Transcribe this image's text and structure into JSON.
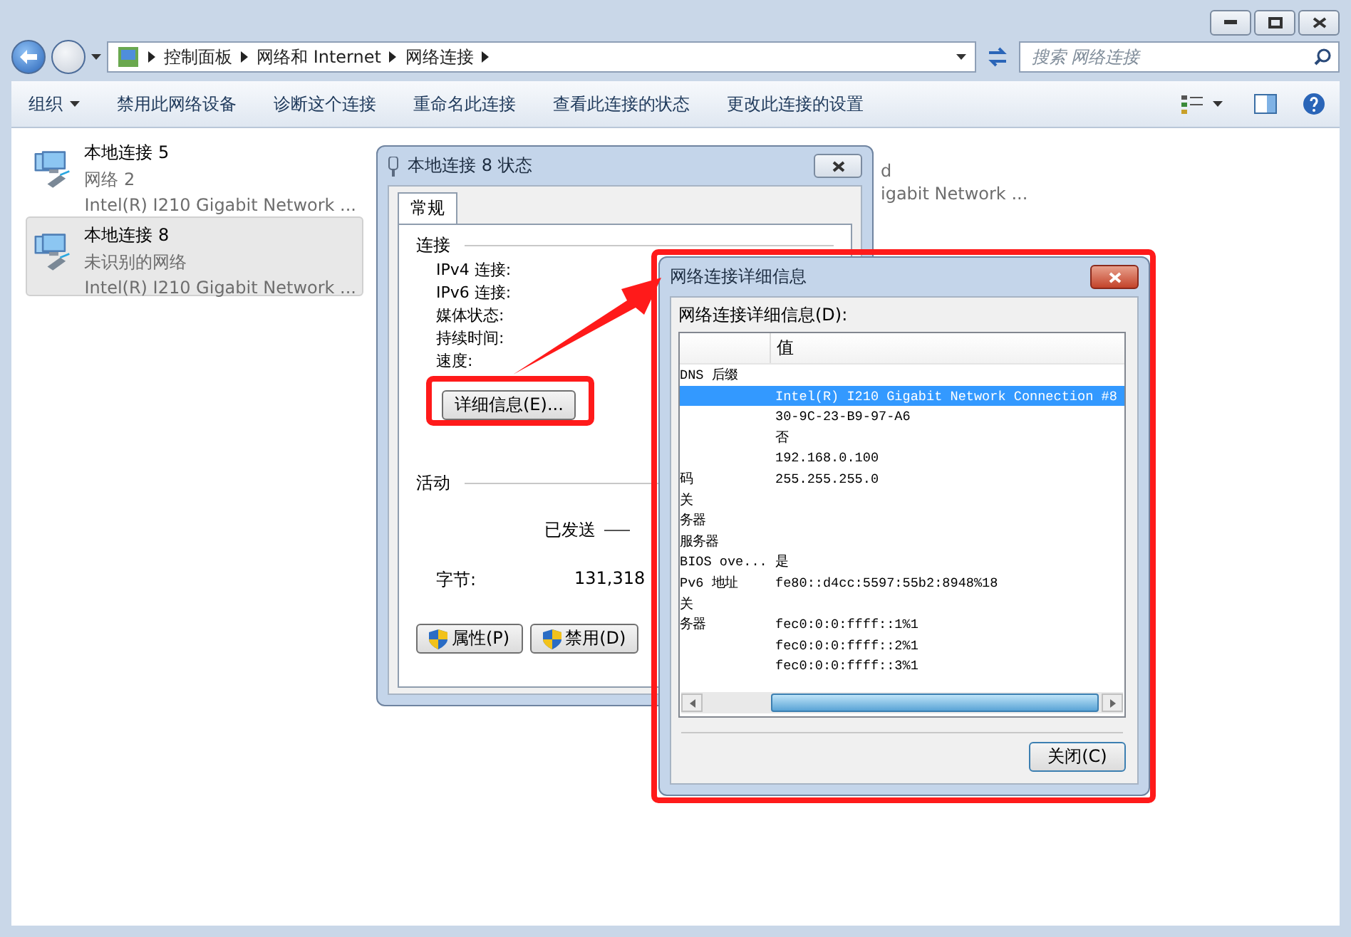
{
  "address_bar": {
    "breadcrumbs": [
      "控制面板",
      "网络和 Internet",
      "网络连接"
    ]
  },
  "search": {
    "placeholder": "搜索 网络连接"
  },
  "toolbar": {
    "items": [
      {
        "label": "组织",
        "dropdown": true
      },
      {
        "label": "禁用此网络设备",
        "dropdown": false
      },
      {
        "label": "诊断这个连接",
        "dropdown": false
      },
      {
        "label": "重命名此连接",
        "dropdown": false
      },
      {
        "label": "查看此连接的状态",
        "dropdown": false
      },
      {
        "label": "更改此连接的设置",
        "dropdown": false
      }
    ]
  },
  "connections": [
    {
      "name": "本地连接 5",
      "status": "网络  2",
      "device": "Intel(R) I210 Gigabit Network ...",
      "selected": false
    },
    {
      "name": "本地连接 8",
      "status": "未识别的网络",
      "device": "Intel(R) I210 Gigabit Network ...",
      "selected": true
    }
  ],
  "partial_connection": {
    "status": "d",
    "device": "igabit Network ..."
  },
  "status_dialog": {
    "title": "本地连接 8 状态",
    "tabs": [
      {
        "label": "常规",
        "selected": true
      }
    ],
    "connection": {
      "heading": "连接",
      "fields": [
        "IPv4 连接:",
        "IPv6 连接:",
        "媒体状态:",
        "持续时间:",
        "速度:"
      ]
    },
    "details_button": "详细信息(E)...",
    "activity": {
      "heading": "活动",
      "sent": "已发送",
      "bytes_label": "字节:",
      "bytes_sent": "131,318"
    },
    "buttons": [
      "属性(P)",
      "禁用(D)"
    ]
  },
  "details_dialog": {
    "title": "网络连接详细信息",
    "label": "网络连接详细信息(D):",
    "value_column": "值",
    "rows": [
      {
        "property": "DNS 后缀",
        "selected": false
      },
      {
        "value": "Intel(R) I210 Gigabit Network Connection #8",
        "selected": true
      },
      {
        "value": "30-9C-23-B9-97-A6",
        "selected": false
      },
      {
        "value": "否",
        "selected": false
      },
      {
        "value": "192.168.0.100",
        "selected": false
      },
      {
        "property": "码",
        "value": "255.255.255.0",
        "selected": false
      },
      {
        "property": "关",
        "selected": false
      },
      {
        "property": "务器",
        "selected": false
      },
      {
        "property": "服务器",
        "selected": false
      },
      {
        "property": "BIOS ove...",
        "value": "是",
        "selected": false
      },
      {
        "property": "Pv6 地址",
        "value": "fe80::d4cc:5597:55b2:8948%18",
        "selected": false
      },
      {
        "property": "关",
        "selected": false
      },
      {
        "property": "务器",
        "value": "fec0:0:0:ffff::1%1",
        "selected": false
      },
      {
        "value": "fec0:0:0:ffff::2%1",
        "selected": false
      },
      {
        "value": "fec0:0:0:ffff::3%1",
        "selected": false
      }
    ],
    "close_button": "关闭(C)"
  }
}
